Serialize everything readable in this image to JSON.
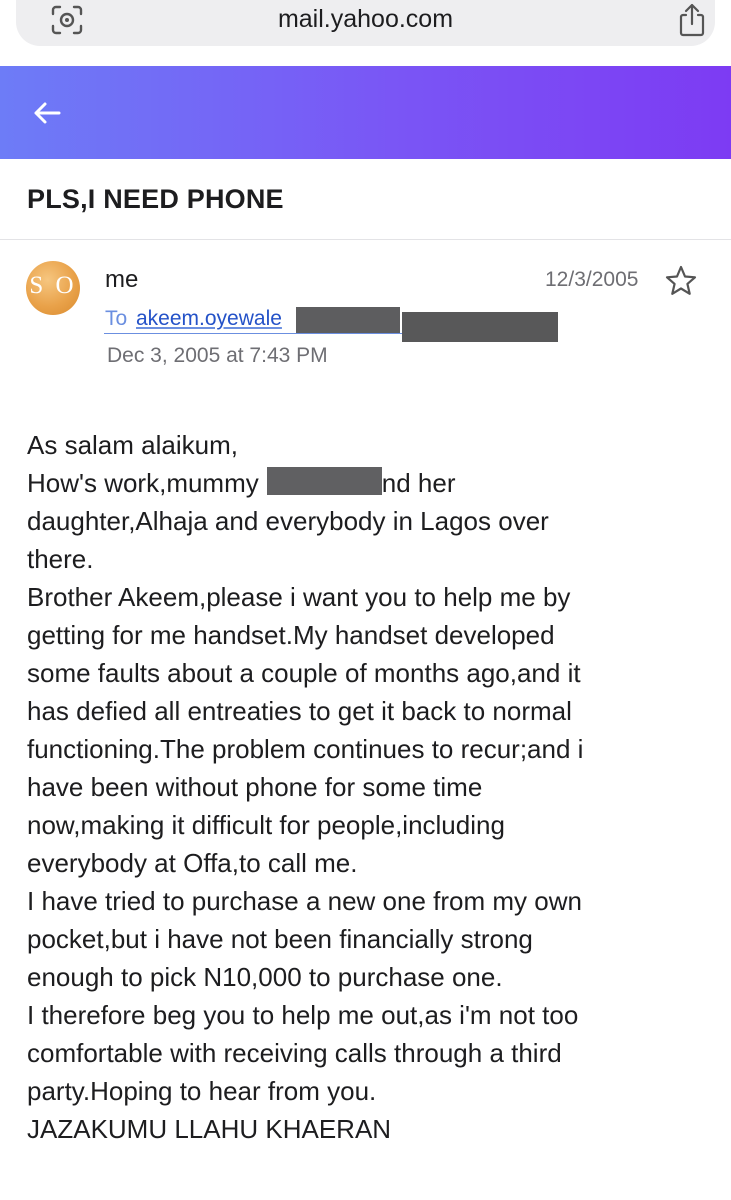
{
  "browser": {
    "url": "mail.yahoo.com",
    "left_icon": "site-settings-icon",
    "right_icon": "share-icon"
  },
  "header": {
    "back_icon": "arrow-left-icon",
    "gradient": [
      "#6d7cf7",
      "#7d3bf3"
    ]
  },
  "email": {
    "subject": "PLS,I NEED PHONE",
    "avatar_initials": "S O",
    "sender": "me",
    "date_short": "12/3/2005",
    "star_icon": "star-outline-icon",
    "to_label": "To",
    "to_address": "akeem.oyewale",
    "date_long": "Dec 3, 2005 at 7:43 PM",
    "body": {
      "line_1": "As salam alaikum,",
      "line_2_a": "How's work,mummy",
      "line_2_b": "nd her",
      "lines": [
        "daughter,Alhaja and everybody in Lagos over",
        "there.",
        "Brother Akeem,please i want you to help me by",
        "getting for me handset.My handset developed",
        "some faults about a couple of months ago,and it",
        "has defied all entreaties to get it back to normal",
        "functioning.The problem continues to recur;and i",
        "have been without phone for some time",
        "now,making it difficult for people,including",
        "everybody at Offa,to call me.",
        "I have tried to purchase a new one from my own",
        "pocket,but i have not been financially  strong",
        "enough to pick N10,000 to purchase one.",
        "I therefore beg you to help me out,as i'm not too",
        "comfortable with receiving calls  through a  third",
        "party.Hoping to hear from you.",
        "JAZAKUMU LLAHU KHAERAN"
      ]
    }
  },
  "colors": {
    "link": "#2452c8",
    "muted": "#6e6e73",
    "redaction": "#5d5d5f",
    "avatar": "#e9a24a"
  }
}
